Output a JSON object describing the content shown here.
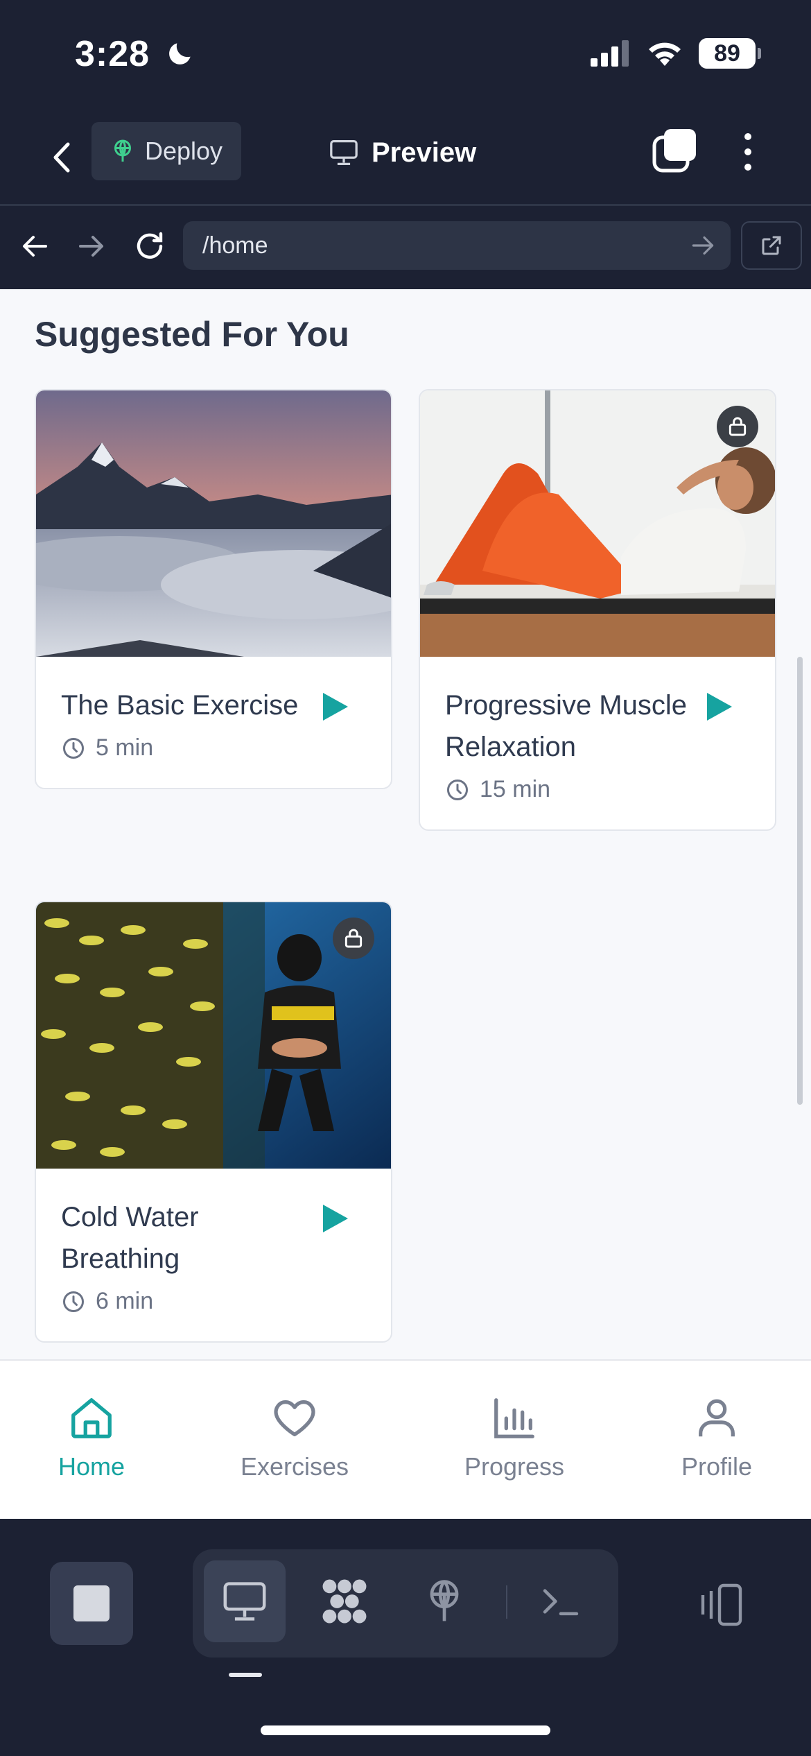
{
  "status_bar": {
    "time": "3:28",
    "battery": "89"
  },
  "header": {
    "deploy_label": "Deploy",
    "preview_label": "Preview"
  },
  "browser": {
    "url": "/home"
  },
  "content": {
    "section_title": "Suggested For You",
    "cards": [
      {
        "title": "The Basic Exercise",
        "duration": "5 min",
        "locked": false
      },
      {
        "title": "Progressive Muscle Relaxation",
        "duration": "15 min",
        "locked": true
      },
      {
        "title": "Cold Water Breathing",
        "duration": "6 min",
        "locked": true
      }
    ]
  },
  "bottom_nav": {
    "items": [
      {
        "label": "Home",
        "icon": "home-icon",
        "active": true
      },
      {
        "label": "Exercises",
        "icon": "heart-icon",
        "active": false
      },
      {
        "label": "Progress",
        "icon": "bar-chart-icon",
        "active": false
      },
      {
        "label": "Profile",
        "icon": "person-icon",
        "active": false
      }
    ]
  },
  "colors": {
    "accent": "#16a3a0",
    "dark_bg": "#1c2133",
    "title_text": "#2e3648"
  }
}
